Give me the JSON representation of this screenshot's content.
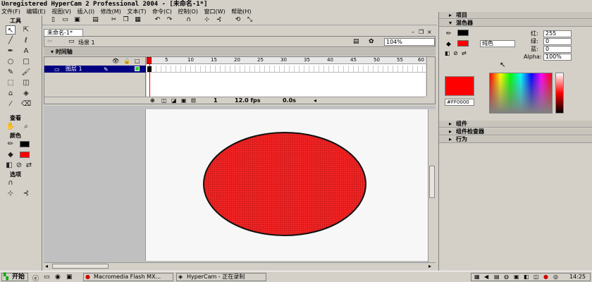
{
  "window": {
    "title": "Unregistered HyperCam 2 Professional 2004 - [未命名-1*]"
  },
  "menu": [
    "文件(F)",
    "编辑(E)",
    "视图(V)",
    "插入(I)",
    "修改(M)",
    "文本(T)",
    "命令(C)",
    "控制(O)",
    "窗口(W)",
    "帮助(H)"
  ],
  "tools": {
    "title": "工具",
    "view_section": "查看",
    "colors_section": "颜色",
    "options_section": "选项"
  },
  "document": {
    "tab": "未命名-1*",
    "scene": "场景 1",
    "zoom": "104%"
  },
  "timeline": {
    "header": "时间轴",
    "layer_name": "图层 1",
    "ruler_marks": [
      "1",
      "5",
      "10",
      "15",
      "20",
      "25",
      "30",
      "35",
      "40",
      "45",
      "50",
      "55",
      "60"
    ],
    "current_frame": "1",
    "fps": "12.0 fps",
    "time": "0.0s"
  },
  "panels": {
    "project": "项目",
    "color_mixer": "混色器",
    "components": "组件",
    "component_inspector": "组件检查器",
    "actions": "行为"
  },
  "mixer": {
    "fill_type": "纯色",
    "red_label": "红:",
    "red": "255",
    "green_label": "绿:",
    "green": "0",
    "blue_label": "蓝:",
    "blue": "0",
    "alpha_label": "Alpha:",
    "alpha": "100%",
    "hex": "#FF0000",
    "swatch_color": "#ff0000"
  },
  "stage": {
    "shape": "circle",
    "fill_color": "#ee2222",
    "stroke_color": "#111111"
  },
  "taskbar": {
    "start": "开始",
    "tasks": [
      "Macromedia Flash MX...",
      "HyperCam - 正在录制"
    ],
    "clock": "14:25"
  }
}
